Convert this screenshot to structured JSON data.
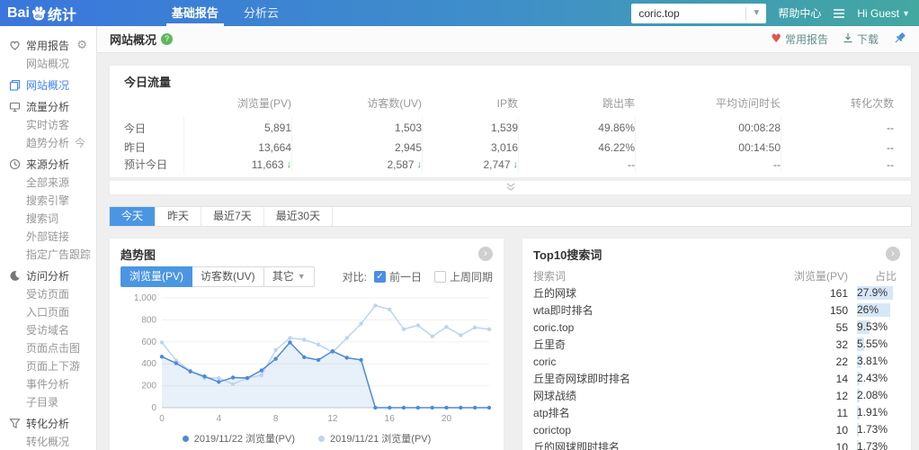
{
  "colors": {
    "header_gradient_start": "#3a76dd",
    "header_gradient_end": "#42a8a0",
    "accent_blue": "#4a90e2",
    "active_tab_blue": "#4b96e3",
    "sidebar_active_blue": "#4285f4",
    "trend_down_green": "#3cb24b",
    "heart_red": "#e0544c",
    "ratio_bar_blue": "#d7e7f8",
    "series_dark_blue": "#4e8ad6",
    "series_light_blue": "#bcd4f0"
  },
  "header": {
    "logo": {
      "prefix": "Bai",
      "paw_text": "du",
      "suffix": "统计"
    },
    "tabs": [
      {
        "label": "基础报告",
        "active": true
      },
      {
        "label": "分析云",
        "active": false
      }
    ],
    "site_selector": {
      "value": "coric.top"
    },
    "help_label": "帮助中心",
    "user_label": "Hi Guest"
  },
  "toolbar": {
    "page_title": "网站概况",
    "favorite_label": "常用报告",
    "download_label": "下载"
  },
  "sidebar": {
    "sections": [
      {
        "label": "常用报告",
        "icon": "heart",
        "gear": true,
        "active": false,
        "items": [
          {
            "label": "网站概况"
          }
        ]
      },
      {
        "label": "网站概况",
        "icon": "pages",
        "active": true,
        "items": []
      },
      {
        "label": "流量分析",
        "icon": "monitor",
        "active": false,
        "items": [
          {
            "label": "实时访客"
          },
          {
            "label": "趋势分析",
            "suffix": "今 昨"
          }
        ]
      },
      {
        "label": "来源分析",
        "icon": "clock",
        "active": false,
        "items": [
          {
            "label": "全部来源"
          },
          {
            "label": "搜索引擎"
          },
          {
            "label": "搜索词"
          },
          {
            "label": "外部链接"
          },
          {
            "label": "指定广告跟踪"
          }
        ]
      },
      {
        "label": "访问分析",
        "icon": "moon",
        "active": false,
        "items": [
          {
            "label": "受访页面"
          },
          {
            "label": "入口页面"
          },
          {
            "label": "受访域名"
          },
          {
            "label": "页面点击图"
          },
          {
            "label": "页面上下游"
          },
          {
            "label": "事件分析"
          },
          {
            "label": "子目录"
          }
        ]
      },
      {
        "label": "转化分析",
        "icon": "funnel",
        "active": false,
        "items": [
          {
            "label": "转化概况"
          }
        ]
      }
    ]
  },
  "today_traffic": {
    "title": "今日流量",
    "columns": [
      "浏览量(PV)",
      "访客数(UV)",
      "IP数",
      "跳出率",
      "平均访问时长",
      "转化次数"
    ],
    "rows": [
      {
        "label": "今日",
        "emphasis": true,
        "values": [
          "5,891",
          "1,503",
          "1,539",
          "49.86%",
          "00:08:28",
          "--"
        ],
        "down": [
          false,
          false,
          false,
          false,
          false,
          false
        ]
      },
      {
        "label": "昨日",
        "emphasis": false,
        "values": [
          "13,664",
          "2,945",
          "3,016",
          "46.22%",
          "00:14:50",
          "--"
        ],
        "down": [
          false,
          false,
          false,
          false,
          false,
          false
        ]
      },
      {
        "label": "预计今日",
        "emphasis": false,
        "values": [
          "11,663",
          "2,587",
          "2,747",
          "--",
          "--",
          "--"
        ],
        "down": [
          true,
          true,
          true,
          false,
          false,
          false
        ]
      }
    ]
  },
  "date_tabs": [
    {
      "label": "今天",
      "active": true
    },
    {
      "label": "昨天",
      "active": false
    },
    {
      "label": "最近7天",
      "active": false
    },
    {
      "label": "最近30天",
      "active": false
    }
  ],
  "trend_panel": {
    "title": "趋势图",
    "metric_buttons": [
      {
        "label": "浏览量(PV)",
        "active": true,
        "dropdown": false
      },
      {
        "label": "访客数(UV)",
        "active": false,
        "dropdown": false
      },
      {
        "label": "其它",
        "active": false,
        "dropdown": true
      }
    ],
    "compare_label": "对比:",
    "compare_options": [
      {
        "label": "前一日",
        "checked": true
      },
      {
        "label": "上周同期",
        "checked": false
      }
    ]
  },
  "chart_data": {
    "type": "line",
    "x": [
      0,
      1,
      2,
      3,
      4,
      5,
      6,
      7,
      8,
      9,
      10,
      11,
      12,
      13,
      14,
      15,
      16,
      17,
      18,
      19,
      20,
      21,
      22,
      23
    ],
    "xticks": [
      0,
      4,
      8,
      12,
      16,
      20
    ],
    "yticks": [
      "0",
      "200",
      "400",
      "600",
      "800",
      "1,000"
    ],
    "ylim": [
      0,
      1000
    ],
    "grid": true,
    "legend_position": "bottom",
    "series": [
      {
        "name": "2019/11/22 浏览量(PV)",
        "color": "#4e8ad6",
        "fill": "rgba(94,146,216,0.14)",
        "values": [
          465,
          405,
          330,
          285,
          235,
          275,
          270,
          340,
          445,
          595,
          460,
          435,
          515,
          455,
          435,
          0,
          0,
          0,
          0,
          0,
          0,
          0,
          0,
          0
        ]
      },
      {
        "name": "2019/11/21 浏览量(PV)",
        "color": "#bcd4f0",
        "fill": null,
        "values": [
          595,
          430,
          335,
          270,
          270,
          215,
          270,
          295,
          525,
          635,
          620,
          575,
          505,
          635,
          765,
          930,
          895,
          715,
          750,
          650,
          735,
          660,
          730,
          715
        ]
      }
    ]
  },
  "top_keywords": {
    "title": "Top10搜索词",
    "columns": [
      "搜索词",
      "浏览量(PV)",
      "占比"
    ],
    "rows": [
      {
        "keyword": "丘的网球",
        "pv": "161",
        "ratio": "27.9%"
      },
      {
        "keyword": "wta即时排名",
        "pv": "150",
        "ratio": "26%"
      },
      {
        "keyword": "coric.top",
        "pv": "55",
        "ratio": "9.53%"
      },
      {
        "keyword": "丘里奇",
        "pv": "32",
        "ratio": "5.55%"
      },
      {
        "keyword": "coric",
        "pv": "22",
        "ratio": "3.81%"
      },
      {
        "keyword": "丘里奇网球即时排名",
        "pv": "14",
        "ratio": "2.43%"
      },
      {
        "keyword": "网球战绩",
        "pv": "12",
        "ratio": "2.08%"
      },
      {
        "keyword": "atp排名",
        "pv": "11",
        "ratio": "1.91%"
      },
      {
        "keyword": "corictop",
        "pv": "10",
        "ratio": "1.73%"
      },
      {
        "keyword": "丘的网球即时排名",
        "pv": "10",
        "ratio": "1.73%"
      }
    ]
  }
}
